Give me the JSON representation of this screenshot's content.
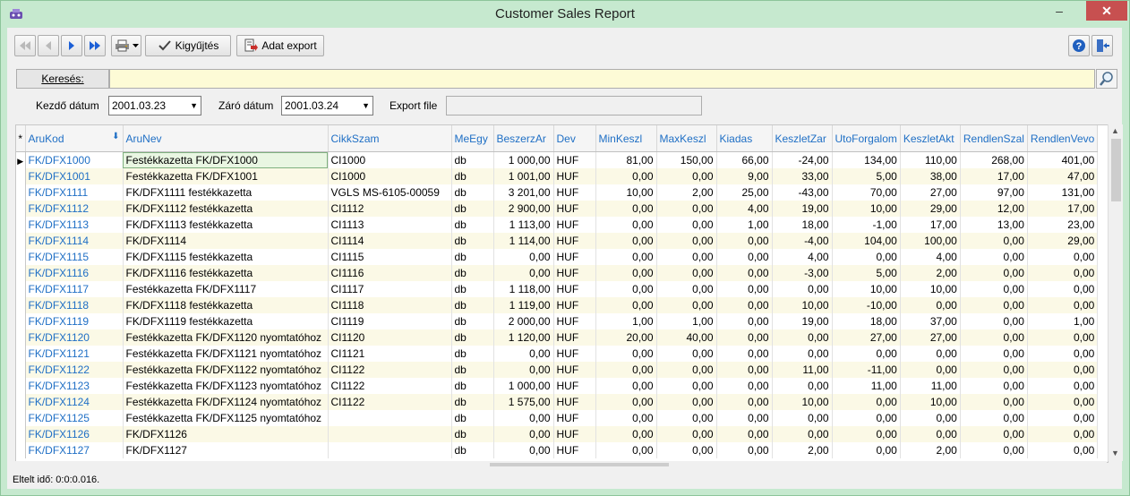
{
  "window": {
    "title": "Customer Sales Report",
    "min_glyph": "–",
    "max_glyph": "□",
    "close_glyph": "✕"
  },
  "toolbar": {
    "kigyujtes_label": "Kigyűjtés",
    "export_label": "Adat export"
  },
  "search": {
    "label": "Keresés:",
    "value": ""
  },
  "filters": {
    "start_label": "Kezdő dátum",
    "start_value": "2001.03.23",
    "end_label": "Záró dátum",
    "end_value": "2001.03.24",
    "export_label": "Export file",
    "export_value": ""
  },
  "grid": {
    "indicator_header": "*",
    "columns": [
      "AruKod",
      "AruNev",
      "CikkSzam",
      "MeEgy",
      "BeszerzAr",
      "Dev",
      "MinKeszl",
      "MaxKeszl",
      "Kiadas",
      "KeszletZar",
      "UtoForgalom",
      "KeszletAkt",
      "RendlenSzal",
      "RendlenVevo"
    ],
    "rows": [
      [
        "FK/DFX1000",
        "Festékkazetta FK/DFX1000",
        "CI1000",
        "db",
        "1 000,00",
        "HUF",
        "81,00",
        "150,00",
        "66,00",
        "-24,00",
        "134,00",
        "110,00",
        "268,00",
        "401,00"
      ],
      [
        "FK/DFX1001",
        "Festékkazetta FK/DFX1001",
        "CI1000",
        "db",
        "1 001,00",
        "HUF",
        "0,00",
        "0,00",
        "9,00",
        "33,00",
        "5,00",
        "38,00",
        "17,00",
        "47,00"
      ],
      [
        "FK/DFX1111",
        "FK/DFX1111 festékkazetta",
        "VGLS MS-6105-00059",
        "db",
        "3 201,00",
        "HUF",
        "10,00",
        "2,00",
        "25,00",
        "-43,00",
        "70,00",
        "27,00",
        "97,00",
        "131,00"
      ],
      [
        "FK/DFX1112",
        "FK/DFX1112 festékkazetta",
        "CI1112",
        "db",
        "2 900,00",
        "HUF",
        "0,00",
        "0,00",
        "4,00",
        "19,00",
        "10,00",
        "29,00",
        "12,00",
        "17,00"
      ],
      [
        "FK/DFX1113",
        "FK/DFX1113 festékkazetta",
        "CI1113",
        "db",
        "1 113,00",
        "HUF",
        "0,00",
        "0,00",
        "1,00",
        "18,00",
        "-1,00",
        "17,00",
        "13,00",
        "23,00"
      ],
      [
        "FK/DFX1114",
        "FK/DFX1114",
        "CI1114",
        "db",
        "1 114,00",
        "HUF",
        "0,00",
        "0,00",
        "0,00",
        "-4,00",
        "104,00",
        "100,00",
        "0,00",
        "29,00"
      ],
      [
        "FK/DFX1115",
        "FK/DFX1115 festékkazetta",
        "CI1115",
        "db",
        "0,00",
        "HUF",
        "0,00",
        "0,00",
        "0,00",
        "4,00",
        "0,00",
        "4,00",
        "0,00",
        "0,00"
      ],
      [
        "FK/DFX1116",
        "FK/DFX1116 festékkazetta",
        "CI1116",
        "db",
        "0,00",
        "HUF",
        "0,00",
        "0,00",
        "0,00",
        "-3,00",
        "5,00",
        "2,00",
        "0,00",
        "0,00"
      ],
      [
        "FK/DFX1117",
        "Festékkazetta FK/DFX1117",
        "CI1117",
        "db",
        "1 118,00",
        "HUF",
        "0,00",
        "0,00",
        "0,00",
        "0,00",
        "10,00",
        "10,00",
        "0,00",
        "0,00"
      ],
      [
        "FK/DFX1118",
        "FK/DFX1118 festékkazetta",
        "CI1118",
        "db",
        "1 119,00",
        "HUF",
        "0,00",
        "0,00",
        "0,00",
        "10,00",
        "-10,00",
        "0,00",
        "0,00",
        "0,00"
      ],
      [
        "FK/DFX1119",
        "FK/DFX1119 festékkazetta",
        "CI1119",
        "db",
        "2 000,00",
        "HUF",
        "1,00",
        "1,00",
        "0,00",
        "19,00",
        "18,00",
        "37,00",
        "0,00",
        "1,00"
      ],
      [
        "FK/DFX1120",
        "Festékkazetta FK/DFX1120 nyomtatóhoz",
        "CI1120",
        "db",
        "1 120,00",
        "HUF",
        "20,00",
        "40,00",
        "0,00",
        "0,00",
        "27,00",
        "27,00",
        "0,00",
        "0,00"
      ],
      [
        "FK/DFX1121",
        "Festékkazetta FK/DFX1121 nyomtatóhoz",
        "CI1121",
        "db",
        "0,00",
        "HUF",
        "0,00",
        "0,00",
        "0,00",
        "0,00",
        "0,00",
        "0,00",
        "0,00",
        "0,00"
      ],
      [
        "FK/DFX1122",
        "Festékkazetta FK/DFX1122 nyomtatóhoz",
        "CI1122",
        "db",
        "0,00",
        "HUF",
        "0,00",
        "0,00",
        "0,00",
        "11,00",
        "-11,00",
        "0,00",
        "0,00",
        "0,00"
      ],
      [
        "FK/DFX1123",
        "Festékkazetta FK/DFX1123 nyomtatóhoz",
        "CI1122",
        "db",
        "1 000,00",
        "HUF",
        "0,00",
        "0,00",
        "0,00",
        "0,00",
        "11,00",
        "11,00",
        "0,00",
        "0,00"
      ],
      [
        "FK/DFX1124",
        "Festékkazetta FK/DFX1124 nyomtatóhoz",
        "CI1122",
        "db",
        "1 575,00",
        "HUF",
        "0,00",
        "0,00",
        "0,00",
        "10,00",
        "0,00",
        "10,00",
        "0,00",
        "0,00"
      ],
      [
        "FK/DFX1125",
        "Festékkazetta FK/DFX1125 nyomtatóhoz",
        "",
        "db",
        "0,00",
        "HUF",
        "0,00",
        "0,00",
        "0,00",
        "0,00",
        "0,00",
        "0,00",
        "0,00",
        "0,00"
      ],
      [
        "FK/DFX1126",
        "FK/DFX1126",
        "",
        "db",
        "0,00",
        "HUF",
        "0,00",
        "0,00",
        "0,00",
        "0,00",
        "0,00",
        "0,00",
        "0,00",
        "0,00"
      ],
      [
        "FK/DFX1127",
        "FK/DFX1127",
        "",
        "db",
        "0,00",
        "HUF",
        "0,00",
        "0,00",
        "0,00",
        "2,00",
        "0,00",
        "2,00",
        "0,00",
        "0,00"
      ]
    ]
  },
  "status": {
    "text": "Eltelt idő: 0:0:0.016."
  }
}
